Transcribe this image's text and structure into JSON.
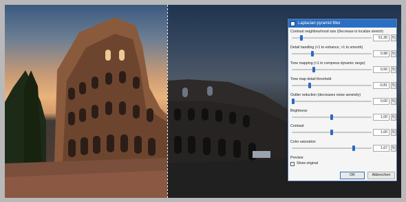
{
  "dialog": {
    "title": "Laplacian pyramid filter",
    "params": [
      {
        "label": "Contrast neighbourhood size (Decrease to localize stretch)",
        "value": "51,36",
        "level": 0.12
      },
      {
        "label": "Detail handling (<1 to enhance, >1 to smooth)",
        "value": "0,98",
        "level": 0.26
      },
      {
        "label": "Tone mapping (<1 to compress dynamic range)",
        "value": "0,56",
        "level": 0.28
      },
      {
        "label": "Tone map detail threshold",
        "value": "-0,81",
        "level": 0.22
      },
      {
        "label": "Outlier reduction (decreases noise sensivity)",
        "value": "0,00",
        "level": 0.02
      },
      {
        "label": "Brightness",
        "value": "1,00",
        "level": 0.5
      },
      {
        "label": "Contrast",
        "value": "1,00",
        "level": 0.5
      },
      {
        "label": "Color saturation",
        "value": "1,67",
        "level": 0.78
      }
    ],
    "reset_glyph": "↻",
    "preview_label": "Preview",
    "show_original_label": "Show original",
    "ok_label": "OK",
    "cancel_label": "Abbrechen"
  },
  "colors": {
    "accent": "#2b6fc3",
    "title_bar": "#2b6fc3",
    "app_background": "#b9b9b9"
  }
}
